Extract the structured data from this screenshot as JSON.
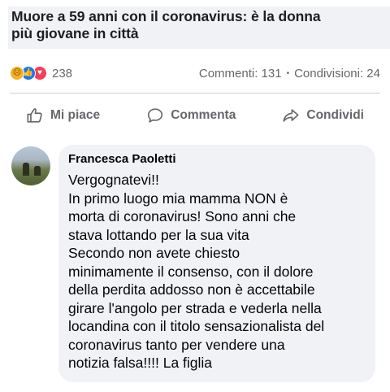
{
  "post": {
    "title_lines": [
      "Muore a 59 anni con il coronavirus: è la donna",
      "più giovane in città"
    ]
  },
  "stats": {
    "reaction_icons": [
      "sad-reaction-icon",
      "like-reaction-icon",
      "love-reaction-icon"
    ],
    "reaction_count": "238",
    "comments": "Commenti: 131",
    "shares": "Condivisioni: 24",
    "separator": "•"
  },
  "actions": {
    "like": "Mi piace",
    "comment": "Commenta",
    "share": "Condividi"
  },
  "comment": {
    "author": "Francesca Paoletti",
    "lines": [
      "Vergognatevi!!",
      "In primo luogo mia mamma NON è",
      "morta di coronavirus! Sono anni che",
      "stava lottando per la sua vita",
      "Secondo non avete chiesto",
      "minimamente il consenso, con il dolore",
      "della perdita addosso non è accettabile",
      "girare l'angolo per strada e vederla nella",
      "locandina con il titolo sensazionalista del",
      "coronavirus tanto per vendere una",
      "notizia falsa!!!! La figlia"
    ]
  },
  "colors": {
    "like_blue": "#1877f2",
    "love_red": "#f33e58",
    "sad_yellow": "#f7b125",
    "secondary_text": "#65676b",
    "bubble_bg": "#f0f2f5"
  }
}
